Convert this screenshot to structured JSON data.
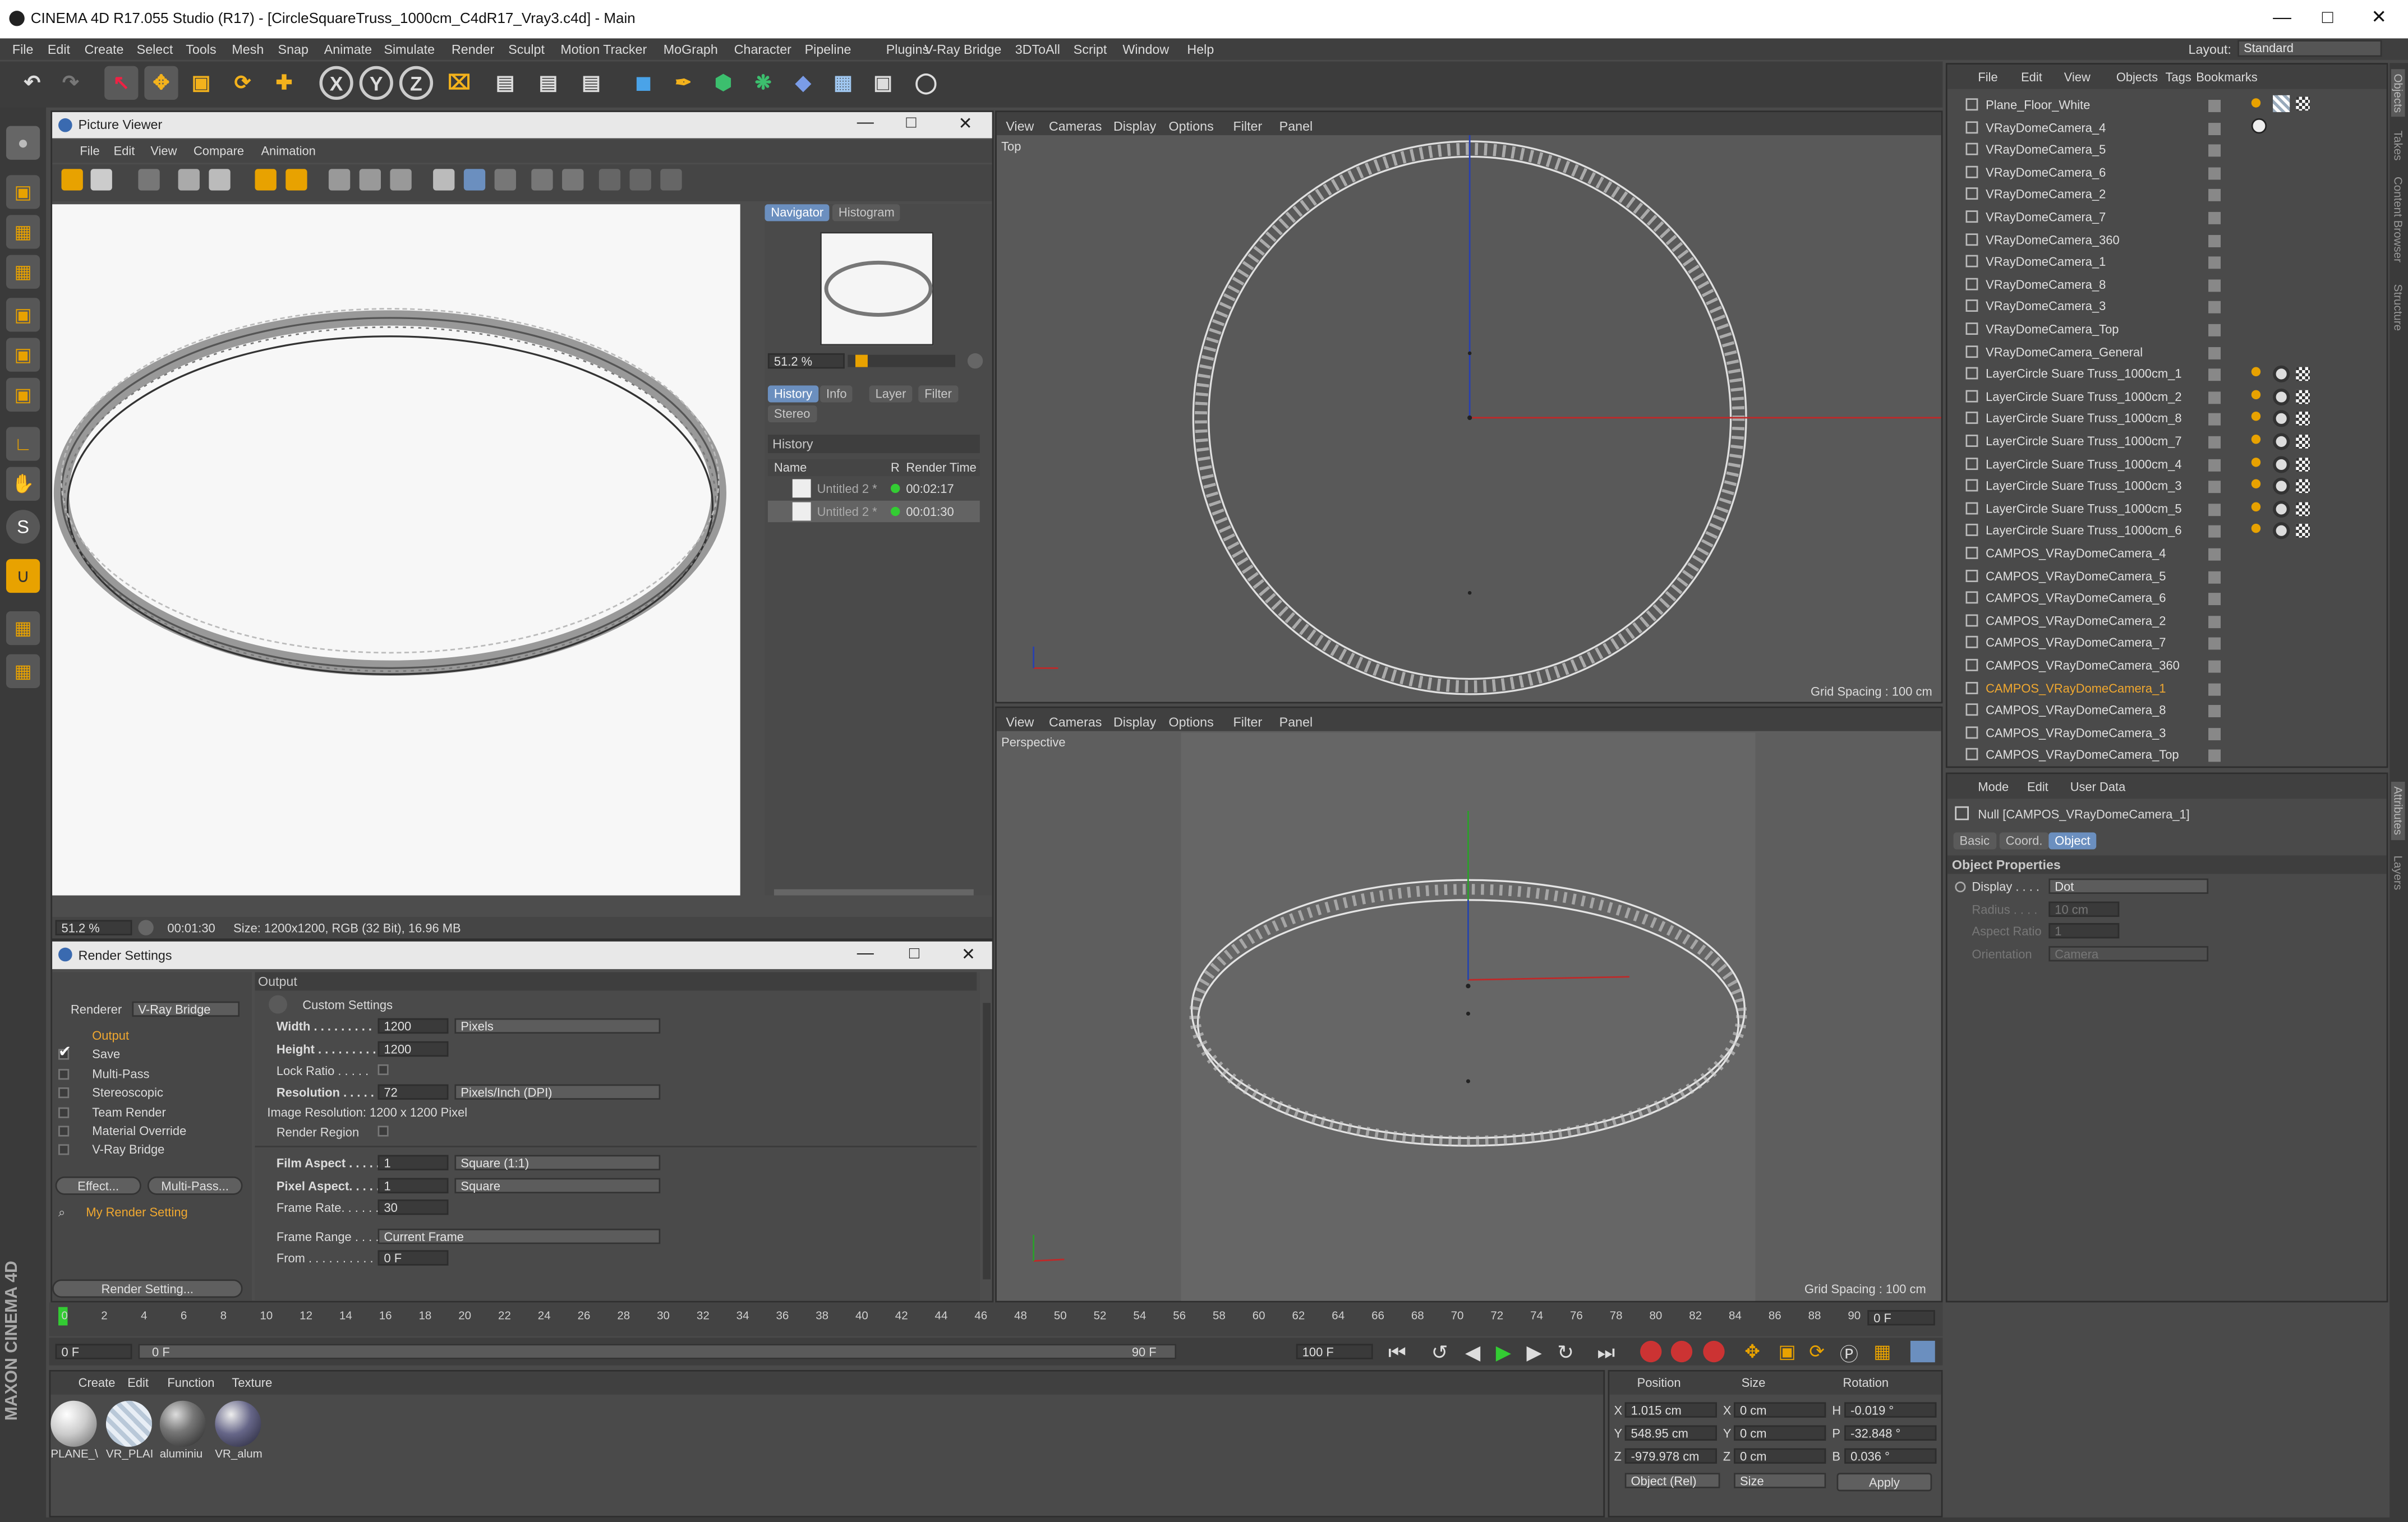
{
  "window": {
    "title": "CINEMA 4D R17.055 Studio (R17) - [CircleSquareTruss_1000cm_C4dR17_Vray3.c4d] - Main",
    "layout_label": "Layout:",
    "layout_value": "Standard"
  },
  "menu": [
    "File",
    "Edit",
    "Create",
    "Select",
    "Tools",
    "Mesh",
    "Snap",
    "Animate",
    "Simulate",
    "Render",
    "Sculpt",
    "Motion Tracker",
    "MoGraph",
    "Character",
    "Pipeline",
    "Plugins",
    "V-Ray Bridge",
    "3DToAll",
    "Script",
    "Window",
    "Help"
  ],
  "toolbar": {
    "x": "X",
    "y": "Y",
    "z": "Z"
  },
  "picture_viewer": {
    "title": "Picture Viewer",
    "menu": [
      "File",
      "Edit",
      "View",
      "Compare",
      "Animation"
    ],
    "tabs": [
      "Navigator",
      "Histogram"
    ],
    "zoom": "51.2 %",
    "subtabs": [
      "History",
      "Info",
      "Layer",
      "Filter",
      "Stereo"
    ],
    "history_label": "History",
    "cols": [
      "Name",
      "R",
      "Render Time"
    ],
    "rows": [
      {
        "name": "Untitled 2 *",
        "time": "00:02:17"
      },
      {
        "name": "Untitled 2 *",
        "time": "00:01:30"
      }
    ],
    "status_zoom": "51.2 %",
    "status_time": "00:01:30",
    "status_size": "Size: 1200x1200, RGB (32 Bit), 16.96 MB"
  },
  "render_settings": {
    "title": "Render Settings",
    "renderer_label": "Renderer",
    "renderer_value": "V-Ray Bridge",
    "items": [
      "Output",
      "Save",
      "Multi-Pass",
      "Stereoscopic",
      "Team Render",
      "Material Override",
      "V-Ray Bridge"
    ],
    "effect_btn": "Effect...",
    "multipass_btn": "Multi-Pass...",
    "my_setting": "My Render Setting",
    "render_setting_btn": "Render Setting...",
    "section": "Output",
    "custom": "Custom Settings",
    "width_label": "Width . . . . . . . . .",
    "width": "1200",
    "width_unit": "Pixels",
    "height_label": "Height . . . . . . . . .",
    "height": "1200",
    "lock_ratio": "Lock Ratio . . . . .",
    "resolution_label": "Resolution . . . . .",
    "resolution": "72",
    "resolution_unit": "Pixels/Inch (DPI)",
    "image_res": "Image Resolution: 1200 x 1200 Pixel",
    "render_region": "Render Region",
    "film_aspect_label": "Film Aspect . . . . .",
    "film_aspect": "1",
    "film_aspect_dd": "Square (1:1)",
    "pixel_aspect_label": "Pixel Aspect. . . . .",
    "pixel_aspect": "1",
    "pixel_aspect_dd": "Square",
    "frame_rate_label": "Frame Rate. . . . . .",
    "frame_rate": "30",
    "frame_range_label": "Frame Range . . . .",
    "frame_range": "Current Frame",
    "from_label": "From . . . . . . . . . .",
    "from": "0 F"
  },
  "viewport_menu": [
    "View",
    "Cameras",
    "Display",
    "Options",
    "Filter",
    "Panel"
  ],
  "viewport_top": {
    "name": "Top",
    "grid": "Grid Spacing : 100 cm"
  },
  "viewport_persp": {
    "name": "Perspective",
    "grid": "Grid Spacing : 100 cm"
  },
  "obj_manager": {
    "menu": [
      "File",
      "Edit",
      "View",
      "Objects",
      "Tags",
      "Bookmarks"
    ],
    "objects": [
      "Plane_Floor_White",
      "VRayDomeCamera_4",
      "VRayDomeCamera_5",
      "VRayDomeCamera_6",
      "VRayDomeCamera_2",
      "VRayDomeCamera_7",
      "VRayDomeCamera_360",
      "VRayDomeCamera_1",
      "VRayDomeCamera_8",
      "VRayDomeCamera_3",
      "VRayDomeCamera_Top",
      "VRayDomeCamera_General",
      "LayerCircle Suare Truss_1000cm_1",
      "LayerCircle Suare Truss_1000cm_2",
      "LayerCircle Suare Truss_1000cm_8",
      "LayerCircle Suare Truss_1000cm_7",
      "LayerCircle Suare Truss_1000cm_4",
      "LayerCircle Suare Truss_1000cm_3",
      "LayerCircle Suare Truss_1000cm_5",
      "LayerCircle Suare Truss_1000cm_6",
      "CAMPOS_VRayDomeCamera_4",
      "CAMPOS_VRayDomeCamera_5",
      "CAMPOS_VRayDomeCamera_6",
      "CAMPOS_VRayDomeCamera_2",
      "CAMPOS_VRayDomeCamera_7",
      "CAMPOS_VRayDomeCamera_360",
      "CAMPOS_VRayDomeCamera_1",
      "CAMPOS_VRayDomeCamera_8",
      "CAMPOS_VRayDomeCamera_3",
      "CAMPOS_VRayDomeCamera_Top"
    ],
    "selected_index": 26
  },
  "attributes": {
    "menu": [
      "Mode",
      "Edit",
      "User Data"
    ],
    "object_name": "Null [CAMPOS_VRayDomeCamera_1]",
    "tabs": [
      "Basic",
      "Coord.",
      "Object"
    ],
    "section": "Object Properties",
    "display_label": "Display . . . .",
    "display_value": "Dot",
    "radius_label": "Radius . . . .",
    "radius_value": "10 cm",
    "aspect_label": "Aspect Ratio",
    "aspect_value": "1",
    "orientation_label": "Orientation",
    "orientation_value": "Camera"
  },
  "side_tabs": [
    "Objects",
    "Takes",
    "Content Browser",
    "Structure",
    "Attributes",
    "Layers"
  ],
  "timeline": {
    "ticks": [
      "0",
      "2",
      "4",
      "6",
      "8",
      "10",
      "12",
      "14",
      "16",
      "18",
      "20",
      "22",
      "24",
      "26",
      "28",
      "30",
      "32",
      "34",
      "36",
      "38",
      "40",
      "42",
      "44",
      "46",
      "48",
      "50",
      "52",
      "54",
      "56",
      "58",
      "60",
      "62",
      "64",
      "66",
      "68",
      "70",
      "72",
      "74",
      "76",
      "78",
      "80",
      "82",
      "84",
      "86",
      "88",
      "90"
    ],
    "current_frame": "0 F",
    "start": "0 F",
    "slider_start": "0 F",
    "slider_end": "90 F",
    "end": "100 F"
  },
  "materials": {
    "menu": [
      "Create",
      "Edit",
      "Function",
      "Texture"
    ],
    "items": [
      "PLANE_\\",
      "VR_PLAI",
      "aluminiu",
      "VR_alum"
    ]
  },
  "coords": {
    "headers": [
      "Position",
      "Size",
      "Rotation"
    ],
    "x_pos": "1.015 cm",
    "y_pos": "548.95 cm",
    "z_pos": "-979.978 cm",
    "x_size": "0 cm",
    "y_size": "0 cm",
    "z_size": "0 cm",
    "h": "-0.019 °",
    "p": "-32.848 °",
    "b": "0.036 °",
    "mode": "Object (Rel)",
    "size_mode": "Size",
    "apply": "Apply",
    "axes": [
      "X",
      "Y",
      "Z"
    ],
    "rot_axes": [
      "H",
      "P",
      "B"
    ]
  },
  "brand": "MAXON CINEMA 4D"
}
